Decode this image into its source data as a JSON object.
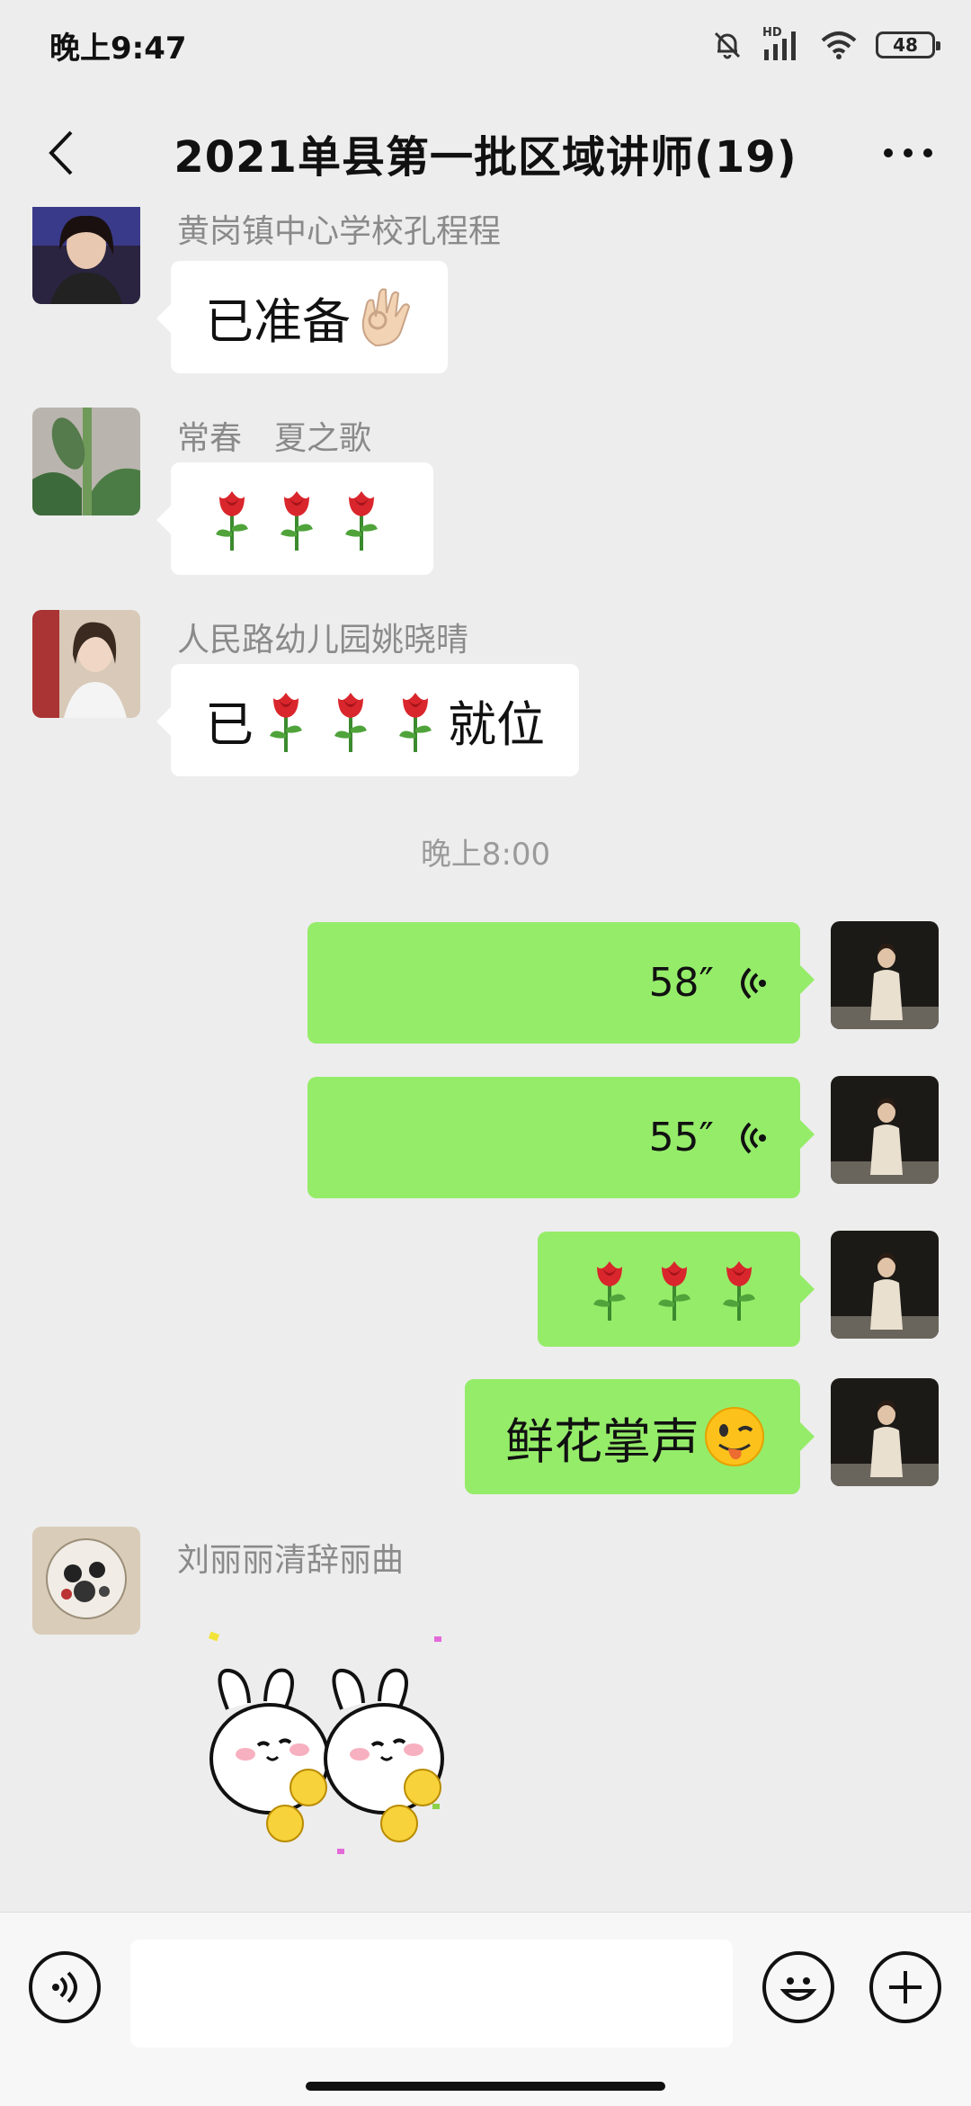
{
  "status": {
    "time": "晚上9:47",
    "battery": "48",
    "network": "HD"
  },
  "header": {
    "title": "2021单县第一批区域讲师(19)"
  },
  "messages": {
    "m1": {
      "sender": "黄岗镇中心学校孔程程",
      "text": "已准备",
      "emoji": "ok-hand"
    },
    "m2": {
      "sender": "常春　夏之歌",
      "emoji": "rose x3"
    },
    "m3": {
      "sender": "人民路幼儿园姚晓晴",
      "text_before": "已",
      "text_after": "就位"
    },
    "timestamp": "晚上8:00",
    "v1": {
      "duration": "58″"
    },
    "v2": {
      "duration": "55″"
    },
    "m6": {
      "emoji": "rose x3"
    },
    "m7": {
      "text": "鲜花掌声"
    },
    "m8": {
      "sender": "刘丽丽清辞丽曲",
      "sticker": "cheering-bunnies-sticker"
    }
  },
  "colors": {
    "outgoing_bubble": "#95ec69",
    "incoming_bubble": "#ffffff",
    "background": "#ededed"
  }
}
